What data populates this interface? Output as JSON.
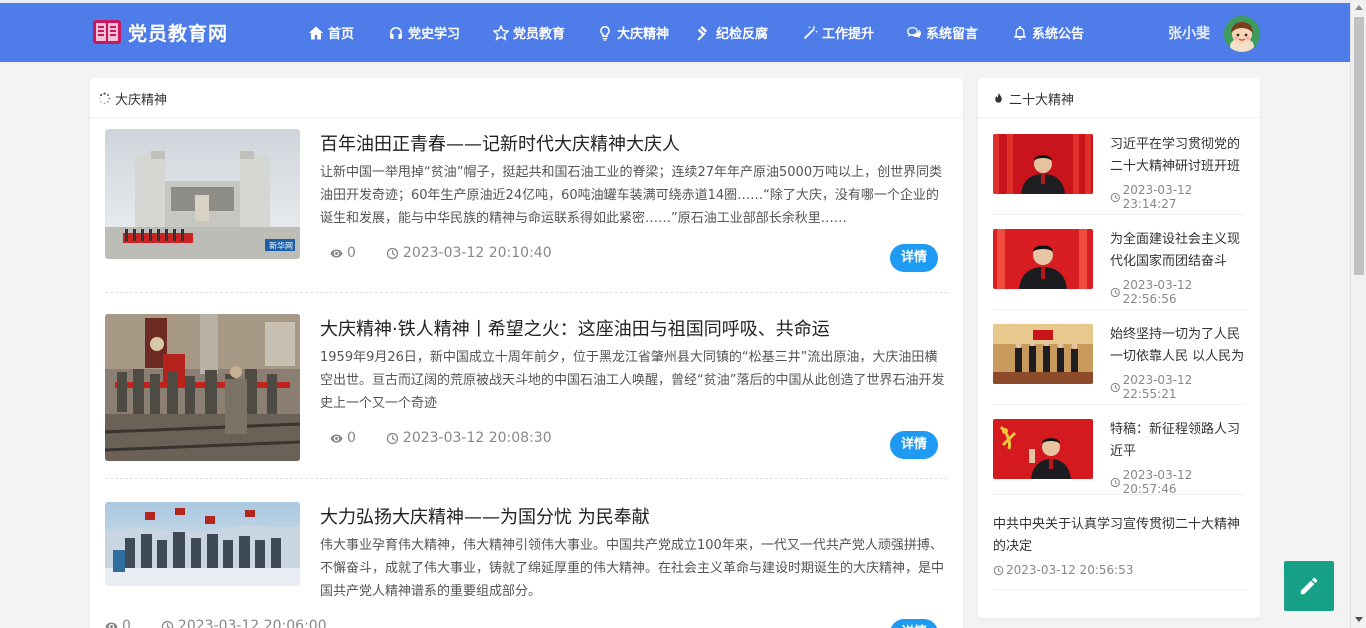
{
  "header": {
    "site_name": "党员教育网",
    "nav": [
      {
        "label": "首页",
        "icon": "home-icon"
      },
      {
        "label": "党史学习",
        "icon": "headphones-icon"
      },
      {
        "label": "党员教育",
        "icon": "star-icon"
      },
      {
        "label": "大庆精神",
        "icon": "lightbulb-icon"
      },
      {
        "label": "纪检反腐",
        "icon": "gavel-icon"
      },
      {
        "label": "工作提升",
        "icon": "magic-wand-icon"
      },
      {
        "label": "系统留言",
        "icon": "chat-icon"
      },
      {
        "label": "系统公告",
        "icon": "bell-icon"
      }
    ],
    "user_name": "张小斐",
    "accent_color": "#4e7ce8"
  },
  "main": {
    "section_title": "大庆精神",
    "articles": [
      {
        "title": "百年油田正青春——记新时代大庆精神大庆人",
        "summary": "让新中国一举甩掉“贫油”帽子，挺起共和国石油工业的脊梁；连续27年年产原油5000万吨以上，创世界同类油田开发奇迹；60年生产原油近24亿吨，60吨油罐车装满可绕赤道14圈……“除了大庆，没有哪一个企业的诞生和发展，能与中华民族的精神与命运联系得如此紧密……”原石油工业部部长余秋里……",
        "views": "0",
        "date": "2023-03-12 20:10:40",
        "detail_label": "详情",
        "image_watermark": "新华网"
      },
      {
        "title": "大庆精神·铁人精神丨希望之火：这座油田与祖国同呼吸、共命运",
        "summary": "1959年9月26日，新中国成立十周年前夕，位于黑龙江省肇州县大同镇的“松基三井”流出原油，大庆油田横空出世。亘古而辽阔的荒原被战天斗地的中国石油工人唤醒，曾经“贫油”落后的中国从此创造了世界石油开发史上一个又一个奇迹",
        "views": "0",
        "date": "2023-03-12 20:08:30",
        "detail_label": "详情"
      },
      {
        "title": "大力弘扬大庆精神——为国分忧 为民奉献",
        "summary": "伟大事业孕育伟大精神，伟大精神引领伟大事业。中国共产党成立100年来，一代又一代共产党人顽强拼搏、不懈奋斗，成就了伟大事业，铸就了绵延厚重的伟大精神。在社会主义革命与建设时期诞生的大庆精神，是中国共产党人精神谱系的重要组成部分。",
        "views": "0",
        "date": "2023-03-12 20:06:00",
        "detail_label": "详情"
      }
    ]
  },
  "side": {
    "section_title": "二十大精神",
    "items": [
      {
        "title": "习近平在学习贯彻党的二十大精神研讨班开班式上发表重要讲话",
        "date": "2023-03-12 23:14:27"
      },
      {
        "title": "为全面建设社会主义现代化国家而团结奋斗",
        "date": "2023-03-12 22:56:56"
      },
      {
        "title": "始终坚持一切为了人民一切依靠人民 以人民为中心",
        "date": "2023-03-12 22:55:21"
      },
      {
        "title": "特稿：新征程领路人习近平",
        "date": "2023-03-12 20:57:46"
      },
      {
        "title": "中共中央关于认真学习宣传贯彻二十大精神的决定",
        "date": "2023-03-12 20:56:53"
      }
    ]
  },
  "fab": {
    "icon": "pencil-icon",
    "color": "#16a085"
  }
}
